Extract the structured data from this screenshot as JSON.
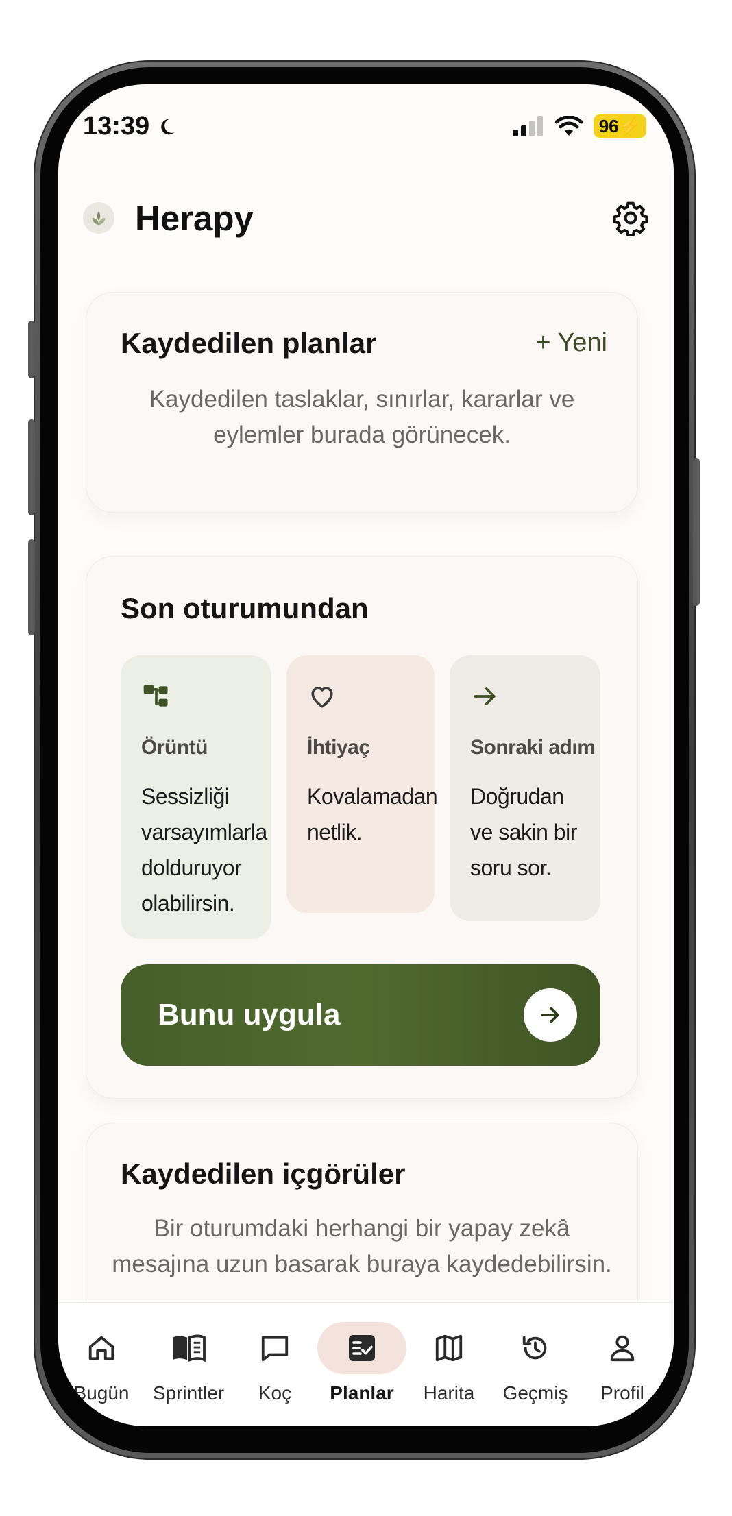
{
  "status": {
    "time": "13:39",
    "battery": "96"
  },
  "header": {
    "title": "Herapy"
  },
  "plans": {
    "title": "Kaydedilen planlar",
    "new_label": "+ Yeni",
    "empty_text": "Kaydedilen taslaklar, sınırlar, kararlar ve eylemler burada görünecek."
  },
  "session": {
    "title": "Son oturumundan",
    "tiles": [
      {
        "label": "Örüntü",
        "text": "Sessizliği varsayımlarla dolduruyor olabilirsin.",
        "icon": "pattern-icon"
      },
      {
        "label": "İhtiyaç",
        "text": "Kovalamadan netlik.",
        "icon": "heart-icon"
      },
      {
        "label": "Sonraki adım",
        "text": "Doğrudan ve sakin bir soru sor.",
        "icon": "arrow-right-icon"
      }
    ],
    "apply_label": "Bunu uygula"
  },
  "insights": {
    "title": "Kaydedilen içgörüler",
    "empty_text": "Bir oturumdaki herhangi bir yapay zekâ mesajına uzun basarak buraya kaydedebilirsin."
  },
  "nav": {
    "items": [
      {
        "label": "Bugün",
        "icon": "home-icon"
      },
      {
        "label": "Sprintler",
        "icon": "book-icon"
      },
      {
        "label": "Koç",
        "icon": "chat-icon"
      },
      {
        "label": "Planlar",
        "icon": "plans-icon",
        "active": true
      },
      {
        "label": "Harita",
        "icon": "map-icon"
      },
      {
        "label": "Geçmiş",
        "icon": "history-icon"
      },
      {
        "label": "Profil",
        "icon": "profile-icon"
      }
    ]
  },
  "colors": {
    "accent": "#4a6229",
    "active_nav_bg": "#f4e3dd",
    "battery": "#f5d21a"
  }
}
